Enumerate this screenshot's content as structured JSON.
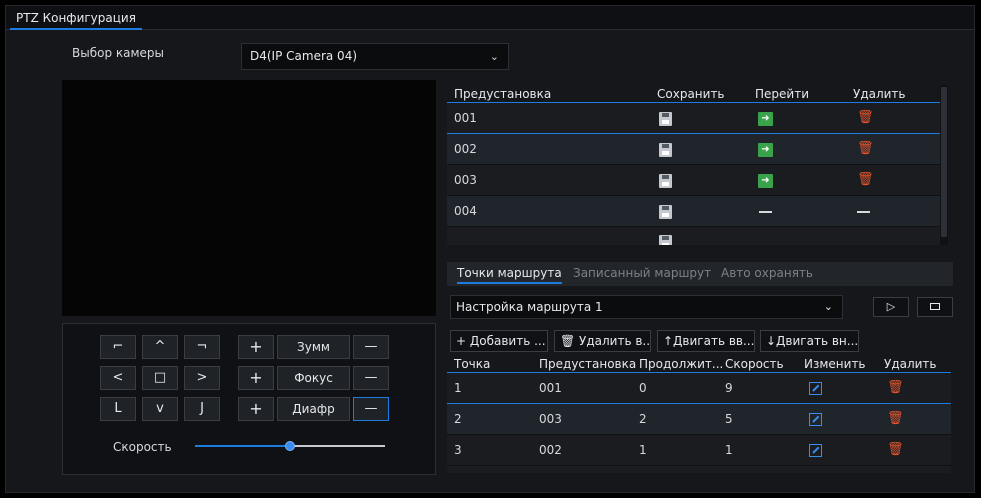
{
  "tabs": {
    "active": "PTZ Конфигурация"
  },
  "camera": {
    "label": "Выбор камеры",
    "selected": "D4(IP Camera 04)"
  },
  "ptz": {
    "dir_buttons": [
      "⌐",
      "^",
      "¬",
      "<",
      "□",
      ">",
      "L",
      "v",
      "J"
    ],
    "zoom_label": "Зумм",
    "focus_label": "Фокус",
    "iris_label": "Диафр",
    "plus": "+",
    "minus": "—",
    "speed_label": "Скорость",
    "speed_value": 0.5
  },
  "presets": {
    "headers": {
      "preset": "Предустановка",
      "save": "Сохранить",
      "goto": "Перейти",
      "delete": "Удалить"
    },
    "rows": [
      {
        "id": "001",
        "go": true
      },
      {
        "id": "002",
        "go": true
      },
      {
        "id": "003",
        "go": true
      },
      {
        "id": "004",
        "go": false
      }
    ],
    "dash": "—"
  },
  "route": {
    "tabs": [
      "Точки маршрута",
      "Записанный маршрут",
      "Авто охранять"
    ],
    "selected_route": "Настройка маршрута 1",
    "toolbar": {
      "add": "+ Добавить ...",
      "delete": "🗑 Удалить в...",
      "move_up": "↑Двигать вв...",
      "move_down": "↓Двигать вн..."
    },
    "headers": {
      "point": "Точка",
      "preset": "Предустановка",
      "duration": "Продолжит...",
      "speed": "Скорость",
      "edit": "Изменить",
      "delete": "Удалить"
    },
    "rows": [
      {
        "point": "1",
        "preset": "001",
        "duration": "0",
        "speed": "9"
      },
      {
        "point": "2",
        "preset": "003",
        "duration": "2",
        "speed": "5"
      },
      {
        "point": "3",
        "preset": "002",
        "duration": "1",
        "speed": "1"
      }
    ]
  },
  "colors": {
    "accent": "#1e7be0",
    "trash": "#e5562f",
    "go": "#38a34a"
  }
}
